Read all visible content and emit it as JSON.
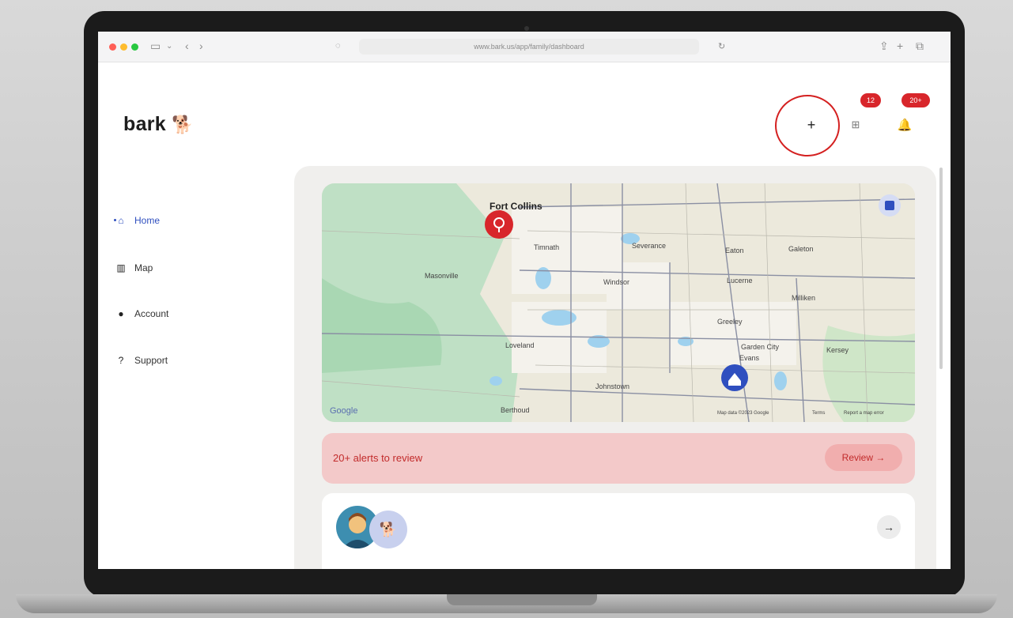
{
  "browser": {
    "url": "www.bark.us/app/family/dashboard"
  },
  "brand": {
    "name": "bark"
  },
  "sidebar": {
    "items": [
      {
        "label": "Home",
        "icon": "home-icon"
      },
      {
        "label": "Map",
        "icon": "map-icon"
      },
      {
        "label": "Account",
        "icon": "person-icon"
      },
      {
        "label": "Support",
        "icon": "help-icon"
      }
    ]
  },
  "header": {
    "add_label": "+",
    "grid_badge": "12",
    "bell_badge": "20+"
  },
  "map": {
    "cities": [
      "Fort Collins",
      "Timnath",
      "Severance",
      "Eaton",
      "Galeton",
      "Masonville",
      "Windsor",
      "Lucerne",
      "Milliken",
      "Greeley",
      "Loveland",
      "Garden City",
      "Evans",
      "Berthoud",
      "Johnstown",
      "Kersey"
    ],
    "google": "Google",
    "footer": [
      "Map data ©2023 Google",
      "Terms",
      "Report a map error"
    ]
  },
  "alerts": {
    "text": "20+ alerts to review",
    "button": "Review →"
  },
  "card": {
    "arrow": "→"
  },
  "colors": {
    "brand": "#2f4fbf",
    "alert": "#d8262b",
    "alert_bg": "#f3c9c9"
  }
}
